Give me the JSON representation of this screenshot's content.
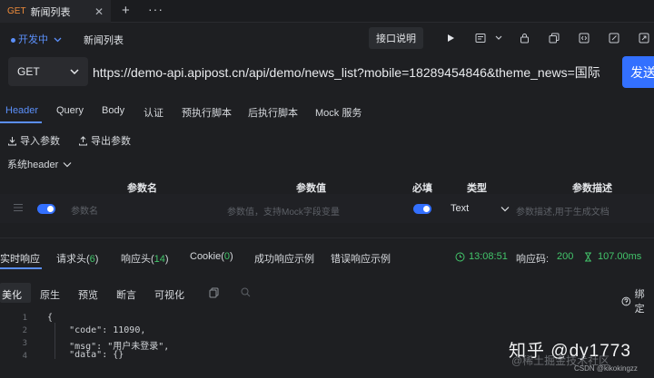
{
  "tab": {
    "method": "GET",
    "title": "新闻列表",
    "close": "✕"
  },
  "tabbar": {
    "add": "+",
    "more": "···"
  },
  "request_bar": {
    "status": "开发中",
    "api_name": "新闻列表",
    "doc_button": "接口说明"
  },
  "url_bar": {
    "method": "GET",
    "url": "https://demo-api.apipost.cn/api/demo/news_list?mobile=18289454846&theme_news=国际",
    "send": "发送"
  },
  "request_tabs": [
    "Header",
    "Query",
    "Body",
    "认证",
    "预执行脚本",
    "后执行脚本",
    "Mock 服务"
  ],
  "params_toolbar": {
    "import": "导入参数",
    "export": "导出参数",
    "system_header": "系统header"
  },
  "table": {
    "headers": {
      "name": "参数名",
      "value": "参数值",
      "required": "必填",
      "type": "类型",
      "description": "参数描述"
    },
    "row": {
      "name_placeholder": "参数名",
      "value_placeholder": "参数值，支持Mock字段变量",
      "type": "Text",
      "description_placeholder": "参数描述,用于生成文档"
    }
  },
  "response_tabs": {
    "realtime": "实时响应",
    "req_headers": "请求头(",
    "req_headers_count": "6",
    "req_headers_end": ")",
    "resp_headers": "响应头(",
    "resp_headers_count": "14",
    "resp_headers_end": ")",
    "cookie": "Cookie(",
    "cookie_count": "0",
    "cookie_end": ")",
    "success_example": "成功响应示例",
    "error_example": "错误响应示例"
  },
  "response_meta": {
    "time": "13:08:51",
    "code_label": "响应码:",
    "code": "200",
    "duration": "107.00ms"
  },
  "view_tabs": [
    "美化",
    "原生",
    "预览",
    "断言",
    "可视化"
  ],
  "bind_label": "绑定",
  "code_lines": [
    {
      "no": "1",
      "text": "{"
    },
    {
      "no": "2",
      "text": "    \"code\": 11090,"
    },
    {
      "no": "3",
      "text": "    \"msg\": \"用户未登录\","
    },
    {
      "no": "4",
      "text": "    \"data\": {}"
    }
  ],
  "watermark": {
    "main": "知乎 @dy1773",
    "sub": "@稀土掘金技术社区",
    "csdn": "CSDN @kikokingzz"
  },
  "colors": {
    "accent": "#3370ff",
    "link": "#5b8ff9",
    "success": "#43c56b",
    "method_get": "#f08c3a"
  }
}
